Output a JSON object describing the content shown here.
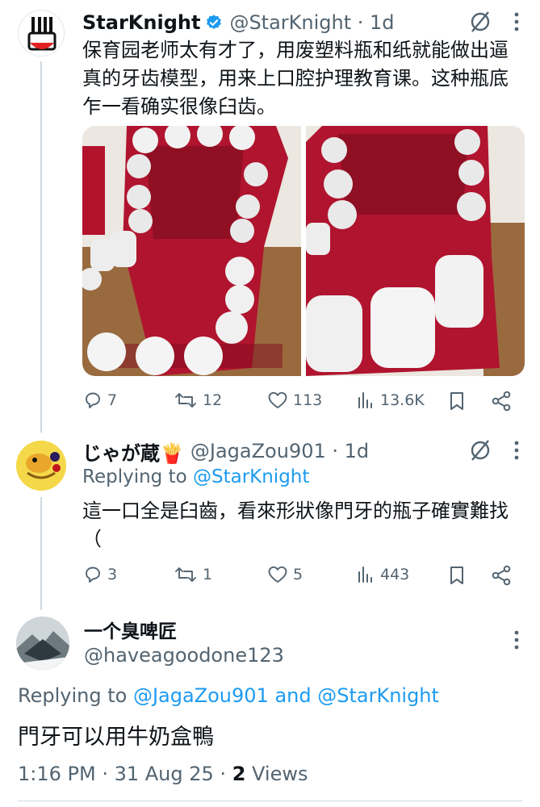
{
  "tweet1": {
    "name": "StarKnight",
    "handle_time": "@StarKnight · 1d",
    "text": "保育园老师太有才了，用废塑料瓶和纸就能做出逼真的牙齿模型，用来上口腔护理教育课。这种瓶底乍一看确实很像臼齿。",
    "stats": {
      "replies": "7",
      "reposts": "12",
      "likes": "113",
      "views": "13.6K"
    }
  },
  "tweet2": {
    "name": "じゃが蔵🍟",
    "handle_time": "@JagaZou901 · 1d",
    "replying_prefix": "Replying to ",
    "replying_to": "@StarKnight",
    "text": "這一口全是臼齒，看來形狀像門牙的瓶子確實難找（",
    "stats": {
      "replies": "3",
      "reposts": "1",
      "likes": "5",
      "views": "443"
    }
  },
  "tweet3": {
    "name": "一个臭啤匠",
    "handle": "@haveagoodone123",
    "replying_prefix": "Replying to ",
    "replying_to_1": "@JagaZou901",
    "replying_and": " and ",
    "replying_to_2": "@StarKnight",
    "text": "門牙可以用牛奶盒鴨",
    "time_date": "1:16 PM · 31 Aug 25 · ",
    "views_count": "2",
    "views_label": " Views"
  },
  "colors": {
    "accent": "#1d9bf0",
    "secondary_text": "#536471",
    "primary_text": "#0f1419",
    "divider": "#cfd9de",
    "board_red": "#b0142e"
  },
  "icons": [
    "verified-badge-icon",
    "grok-icon",
    "more-icon",
    "reply-icon",
    "repost-icon",
    "like-icon",
    "views-icon",
    "bookmark-icon",
    "share-icon"
  ]
}
